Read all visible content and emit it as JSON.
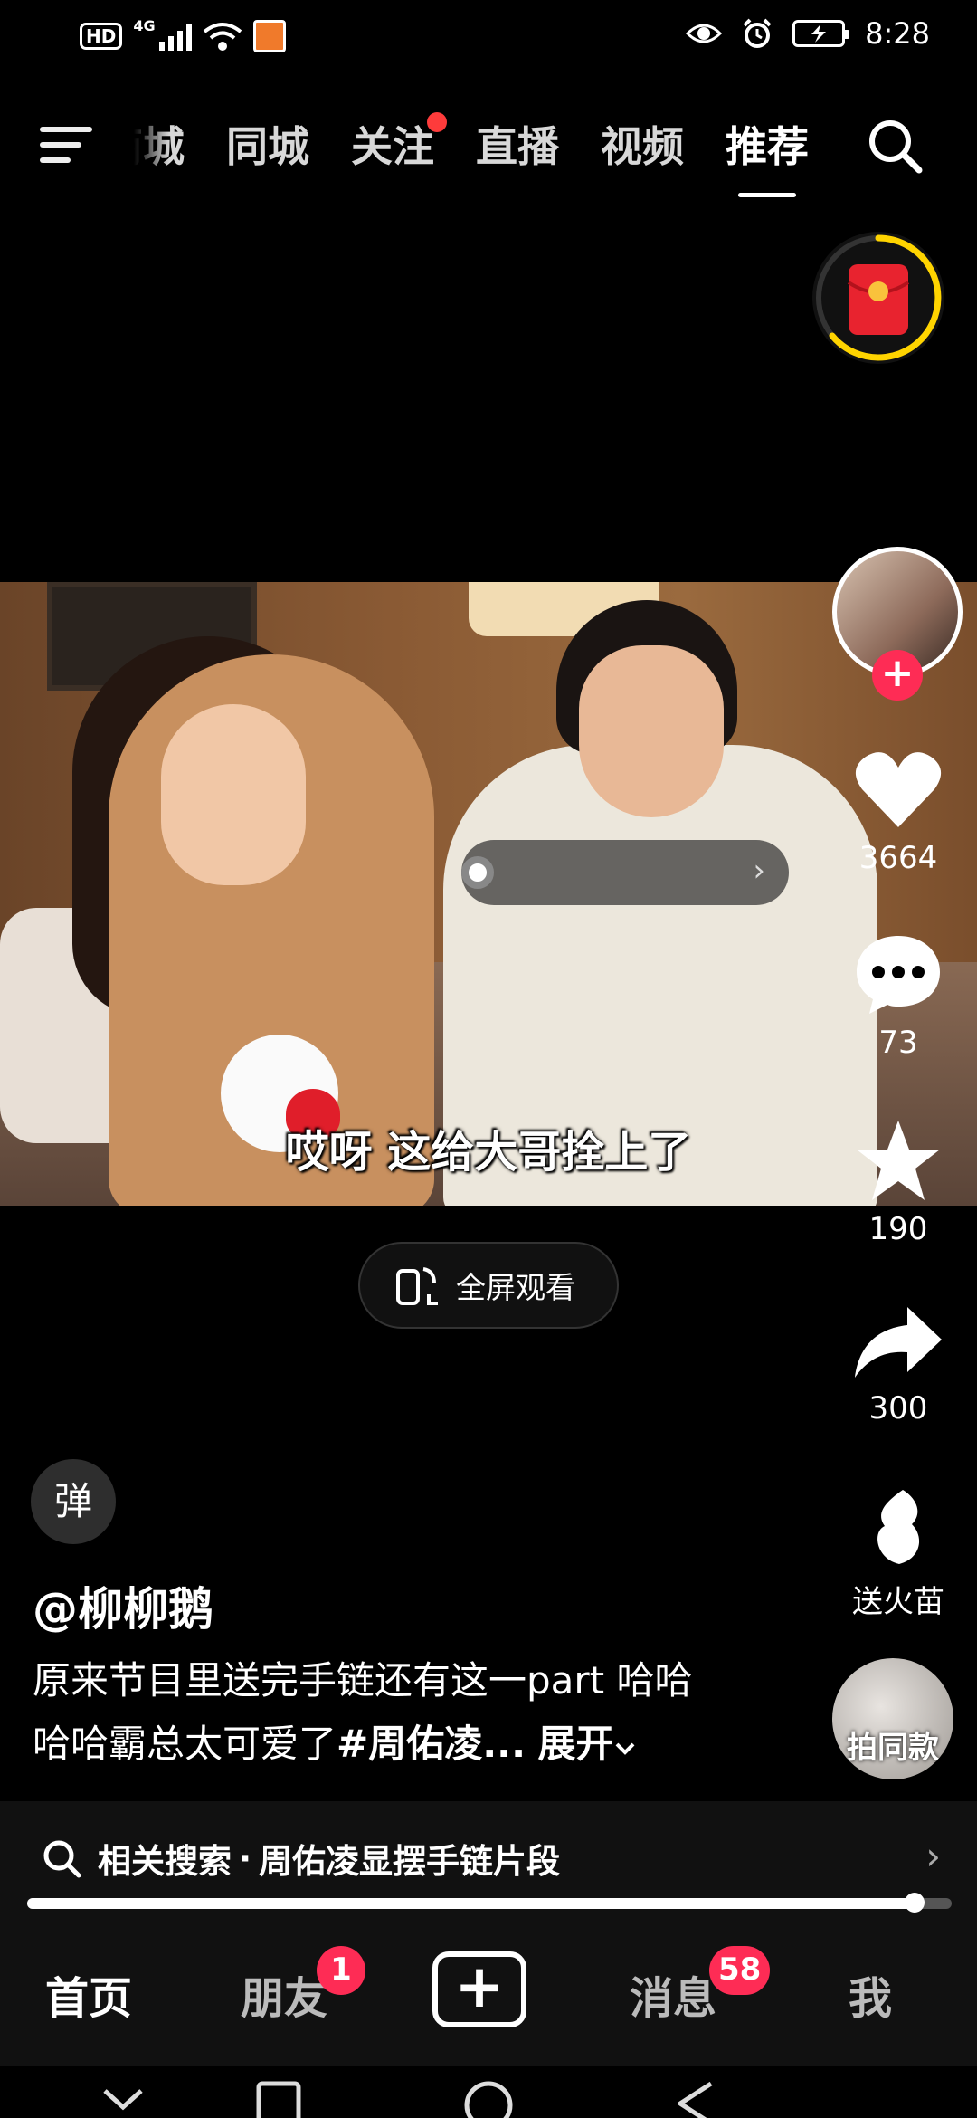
{
  "status_bar": {
    "hd": "HD",
    "network": "4G",
    "time": "8:28"
  },
  "top_nav": {
    "tabs": [
      {
        "label": "商城",
        "clipped": true
      },
      {
        "label": "同城"
      },
      {
        "label": "关注",
        "has_dot": true
      },
      {
        "label": "直播"
      },
      {
        "label": "视频"
      },
      {
        "label": "推荐",
        "active": true
      }
    ]
  },
  "video": {
    "subtitle": "哎呀 这给大哥拴上了"
  },
  "fullscreen_button": {
    "label": "全屏观看"
  },
  "actions": {
    "likes": "3664",
    "comments": "73",
    "favorites": "190",
    "shares": "300",
    "gift_label": "送火苗",
    "same_style_label": "拍同款"
  },
  "danmu_label": "弹",
  "post": {
    "author": "@柳柳鹅",
    "desc_plain": "原来节目里送完手链还有这一part 哈哈哈哈霸总太可爱了",
    "desc_tag": "#周佑凌...",
    "expand_label": "展开"
  },
  "related_search": {
    "prefix": "相关搜索",
    "separator": "·",
    "query": "周佑凌显摆手链片段"
  },
  "playback": {
    "progress_fraction": 0.96
  },
  "bottom_nav": {
    "home": "首页",
    "friends": "朋友",
    "friends_badge": "1",
    "messages": "消息",
    "messages_badge": "58",
    "me": "我"
  },
  "colors": {
    "accent": "#fe2c55",
    "gift_ring": "#ffd400",
    "redpacket": "#e8232f"
  }
}
